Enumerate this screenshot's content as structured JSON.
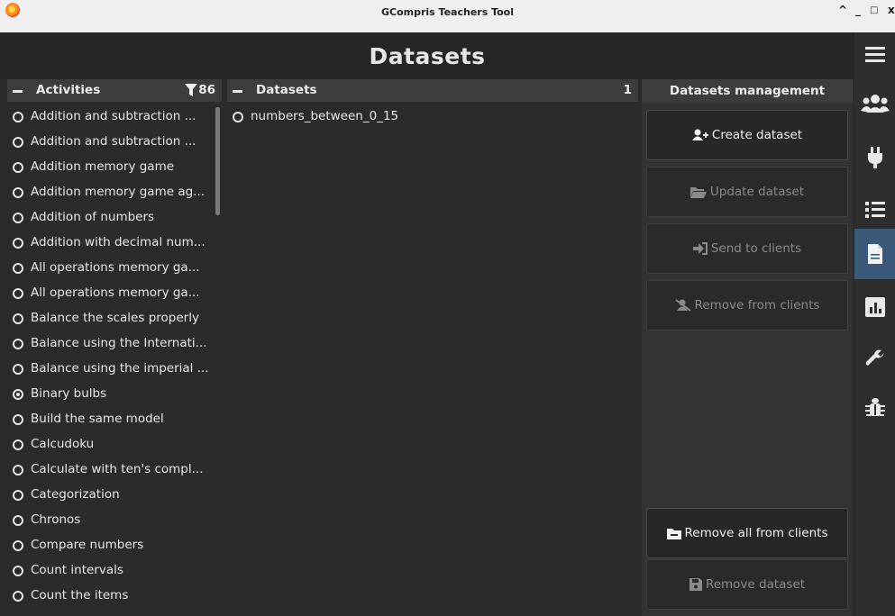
{
  "window": {
    "title": "GCompris Teachers Tool"
  },
  "header": {
    "title": "Datasets"
  },
  "activities": {
    "title": "Activities",
    "count": "86",
    "items": [
      {
        "label": "Addition and subtraction ...",
        "selected": false
      },
      {
        "label": "Addition and subtraction ...",
        "selected": false
      },
      {
        "label": "Addition memory game",
        "selected": false
      },
      {
        "label": "Addition memory game ag...",
        "selected": false
      },
      {
        "label": "Addition of numbers",
        "selected": false
      },
      {
        "label": "Addition with decimal num...",
        "selected": false
      },
      {
        "label": "All operations memory ga...",
        "selected": false
      },
      {
        "label": "All operations memory ga...",
        "selected": false
      },
      {
        "label": "Balance the scales properly",
        "selected": false
      },
      {
        "label": "Balance using the Internati...",
        "selected": false
      },
      {
        "label": "Balance using the imperial ...",
        "selected": false
      },
      {
        "label": "Binary bulbs",
        "selected": true
      },
      {
        "label": "Build the same model",
        "selected": false
      },
      {
        "label": "Calcudoku",
        "selected": false
      },
      {
        "label": "Calculate with ten's compl...",
        "selected": false
      },
      {
        "label": "Categorization",
        "selected": false
      },
      {
        "label": "Chronos",
        "selected": false
      },
      {
        "label": "Compare numbers",
        "selected": false
      },
      {
        "label": "Count intervals",
        "selected": false
      },
      {
        "label": "Count the items",
        "selected": false
      }
    ]
  },
  "datasets": {
    "title": "Datasets",
    "count": "1",
    "items": [
      {
        "label": "numbers_between_0_15",
        "selected": false
      }
    ]
  },
  "management": {
    "title": "Datasets management",
    "create": "Create dataset",
    "update": "Update dataset",
    "send": "Send to clients",
    "remove_from": "Remove from clients",
    "remove_all": "Remove all from clients",
    "remove_dataset": "Remove dataset"
  },
  "icons": {
    "menu": "hamburger-icon",
    "users": "users-icon",
    "plug": "plug-icon",
    "list": "list-icon",
    "document": "document-icon",
    "chart": "bar-chart-icon",
    "wrench": "wrench-icon",
    "bug": "bug-icon"
  },
  "colors": {
    "active_nav": "#3a5877",
    "background": "#2b2b2b",
    "header": "#262626"
  }
}
